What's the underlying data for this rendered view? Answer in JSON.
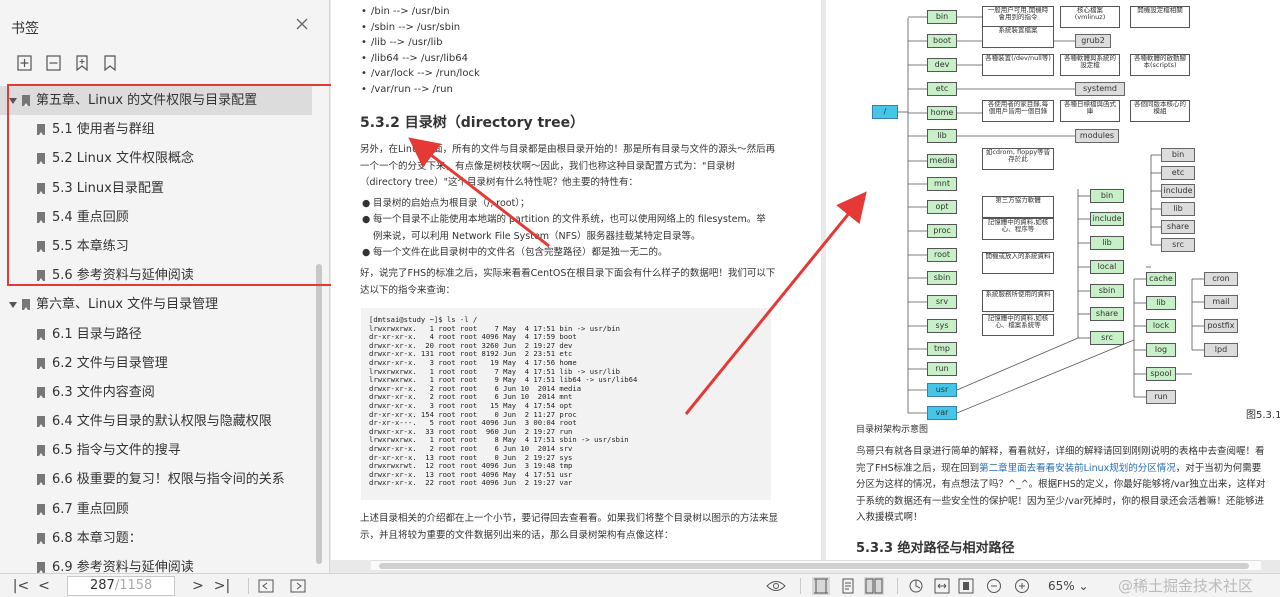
{
  "sidebar": {
    "title": "书签",
    "tools": [
      "add-bookmark-icon",
      "remove-bookmark-icon",
      "bookmark-icon",
      "bookmark-outline-icon"
    ],
    "items": [
      {
        "kind": "ch",
        "label": "第五章、Linux 的文件权限与目录配置",
        "selected": true
      },
      {
        "kind": "sec",
        "label": "5.1 使用者与群组"
      },
      {
        "kind": "sec",
        "label": "5.2 Linux 文件权限概念"
      },
      {
        "kind": "sec",
        "label": "5.3 Linux目录配置"
      },
      {
        "kind": "sec",
        "label": "5.4 重点回顾"
      },
      {
        "kind": "sec",
        "label": "5.5 本章练习"
      },
      {
        "kind": "sec",
        "label": "5.6 参考资料与延伸阅读"
      },
      {
        "kind": "ch",
        "label": "第六章、Linux 文件与目录管理"
      },
      {
        "kind": "sec",
        "label": "6.1 目录与路径"
      },
      {
        "kind": "sec",
        "label": "6.2 文件与目录管理"
      },
      {
        "kind": "sec",
        "label": "6.3 文件内容查阅"
      },
      {
        "kind": "sec",
        "label": "6.4 文件与目录的默认权限与隐藏权限"
      },
      {
        "kind": "sec",
        "label": "6.5 指令与文件的搜寻"
      },
      {
        "kind": "sec",
        "label": "6.6 极重要的复习！权限与指令间的关系"
      },
      {
        "kind": "sec",
        "label": "6.7 重点回顾"
      },
      {
        "kind": "sec",
        "label": "6.8 本章习题："
      },
      {
        "kind": "sec",
        "label": "6.9 参考资料与延伸阅读"
      }
    ]
  },
  "left_page": {
    "links": [
      "/bin --> /usr/bin",
      "/sbin --> /usr/sbin",
      "/lib --> /usr/lib",
      "/lib64 --> /usr/lib64",
      "/var/lock --> /run/lock",
      "/var/run --> /run"
    ],
    "heading_num": "5.3.2",
    "heading_text": "目录树（directory tree）",
    "p1": "另外，在Linux下面，所有的文件与目录都是由根目录开始的！那是所有目录与文件的源头～然后再一个一个的分支下来，有点像是树枝状啊～因此，我们也称这种目录配置方式为：\"目录树（directory tree）\"这个目录树有什么特性呢？他主要的特性有：",
    "bullets": [
      "目录树的启始点为根目录（/, root）；",
      "每一个目录不止能使用本地端的 partition 的文件系统，也可以使用网络上的 filesystem。举例来说，可以利用 Network File System（NFS）服务器挂载某特定目录等。",
      "每一个文件在此目录树中的文件名（包含完整路径）都是独一无二的。"
    ],
    "p2": "好，说完了FHS的标准之后，实际来看看CentOS在根目录下面会有什么样子的数据吧！我们可以下达以下的指令来查询：",
    "code": "[dmtsai@study ~]$ ls -l /\nlrwxrwxrwx.   1 root root    7 May  4 17:51 bin -&gt; usr/bin\ndr-xr-xr-x.   4 root root 4096 May  4 17:59 boot\ndrwxr-xr-x.  20 root root 3260 Jun  2 19:27 dev\ndrwxr-xr-x. 131 root root 8192 Jun  2 23:51 etc\ndrwxr-xr-x.   3 root root   19 May  4 17:56 home\nlrwxrwxrwx.   1 root root    7 May  4 17:51 lib -&gt; usr/lib\nlrwxrwxrwx.   1 root root    9 May  4 17:51 lib64 -&gt; usr/lib64\ndrwxr-xr-x.   2 root root    6 Jun 10  2014 media\ndrwxr-xr-x.   2 root root    6 Jun 10  2014 mnt\ndrwxr-xr-x.   3 root root   15 May  4 17:54 opt\ndr-xr-xr-x. 154 root root    0 Jun  2 11:27 proc\ndr-xr-x---.   5 root root 4096 Jun  3 00:04 root\ndrwxr-xr-x.  33 root root  960 Jun  2 19:27 run\nlrwxrwxrwx.   1 root root    8 May  4 17:51 sbin -&gt; usr/sbin\ndrwxr-xr-x.   2 root root    6 Jun 10  2014 srv\ndr-xr-xr-x.  13 root root    0 Jun  2 19:27 sys\ndrwxrwxrwt.  12 root root 4096 Jun  3 19:48 tmp\ndrwxr-xr-x.  13 root root 4096 May  4 17:51 usr\ndrwxr-xr-x.  22 root root 4096 Jun  2 19:27 var",
    "p3": "上述目录相关的介绍都在上一个小节，要记得回去查看看。如果我们将整个目录树以图示的方法来显示，并且将较为重要的文件数据列出来的话，那么目录树架构有点像这样："
  },
  "right_page": {
    "diagram": {
      "root": "/",
      "col1": [
        "bin",
        "boot",
        "dev",
        "etc",
        "home",
        "lib",
        "media",
        "mnt",
        "opt",
        "proc",
        "root",
        "sbin",
        "srv",
        "sys",
        "tmp",
        "run",
        "usr",
        "var"
      ],
      "descs": [
        "一般用户可用,開機時會用到的指令",
        "核心檔案(vmlinuz)",
        "開機設定檔相關",
        "各種裝置(/dev/null等)",
        "各種軟體與系統的設定檔",
        "各種軟體的啟動腳本(scripts)",
        "系統裝置檔案",
        "各使用者的家目錄,每個用戶皆用一個目錄",
        "各種日標檔與函式庫",
        "各個同版本核心的模組",
        "如cdrom, floppy等皆存於此",
        "第三方協力軟體",
        "記憶體中的資料,如核心、程序等",
        "開機或放入的系統資料",
        "系統服務所使用的資料",
        "記憶體中的資料,如核心、檔案系統等"
      ],
      "grub": "grub2",
      "systemd": "systemd",
      "modules": "modules",
      "usr_children": [
        "bin",
        "include",
        "lib",
        "local",
        "sbin",
        "share",
        "src"
      ],
      "local_children": [
        "bin",
        "etc",
        "include",
        "lib",
        "share",
        "src"
      ],
      "var_children": [
        "cache",
        "lib",
        "lock",
        "log",
        "spool",
        "run"
      ],
      "spool_children": [
        "cron",
        "mail",
        "postfix",
        "lpd"
      ],
      "fig_label": "图5.3.1"
    },
    "caption": "目录树架构示意图",
    "p1a": "鸟哥只有就各目录进行简单的解释，看看就好，详细的解释请回到刚刚说明的表格中去查阅喔！看完了FHS标准之后，现在回到",
    "p1link": "第二章里面去看看安装前Linux规划的分区情况",
    "p1b": "，对于当初为何需要分区为这样的情况，有点想法了吗？^_^。根据FHS的定义，你最好能够将/var独立出来，这样对于系统的数据还有一些安全性的保护呢！因为至少/var死掉时，你的根目录还会活着嘛！还能够进入救援模式啊！",
    "heading_num": "5.3.3",
    "heading_text": "绝对路径与相对路径"
  },
  "statusbar": {
    "first": "|<",
    "prev": "<",
    "page_current": "287",
    "page_total": "/1158",
    "next": ">",
    "last": ">|",
    "zoom": "65%",
    "watermark": "@稀土掘金技术社区"
  },
  "colors": {
    "highlight_red": "#e53935",
    "folder_green": "#c8f0c8",
    "folder_blue": "#45c5e8",
    "file_gray": "#dcdcdc"
  }
}
